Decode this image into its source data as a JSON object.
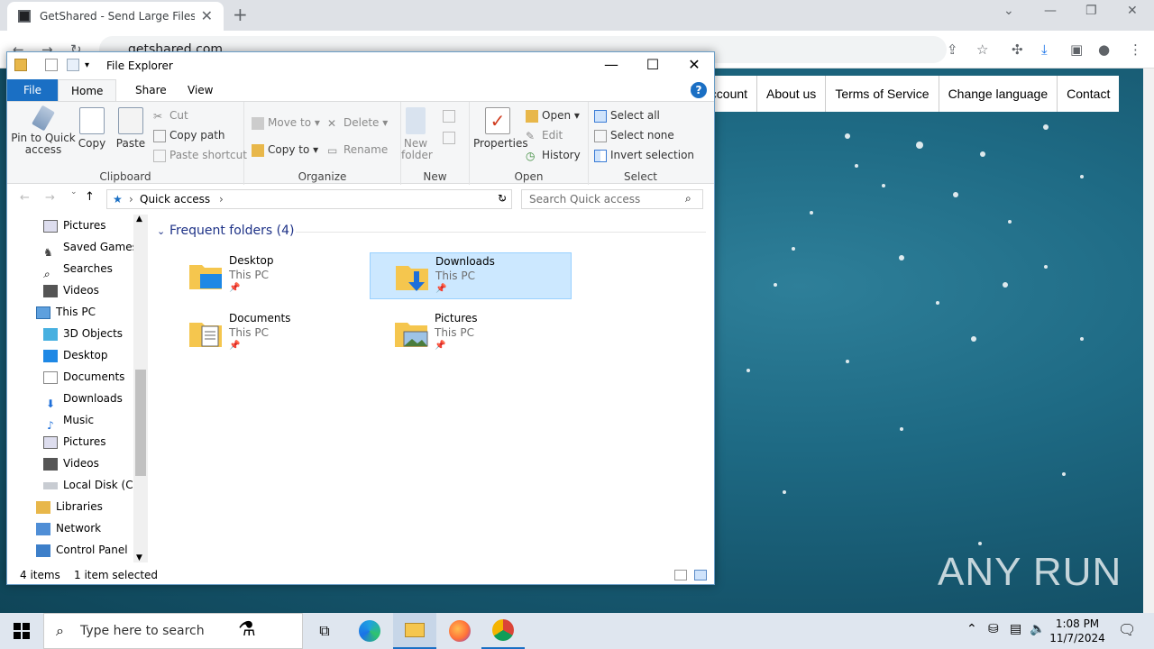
{
  "browser": {
    "tab_title": "GetShared - Send Large Files and",
    "url": "getshared.com",
    "nav_links": [
      "account",
      "About us",
      "Terms of Service",
      "Change language",
      "Contact"
    ]
  },
  "watermark": "ANY RUN",
  "explorer": {
    "title": "File Explorer",
    "tabs": [
      "File",
      "Home",
      "Share",
      "View"
    ],
    "ribbon": {
      "clipboard": {
        "pin": "Pin to Quick access",
        "copy": "Copy",
        "paste": "Paste",
        "cut": "Cut",
        "copy_path": "Copy path",
        "paste_shortcut": "Paste shortcut",
        "label": "Clipboard"
      },
      "organize": {
        "move_to": "Move to",
        "copy_to": "Copy to",
        "delete": "Delete",
        "rename": "Rename",
        "label": "Organize"
      },
      "new": {
        "new_folder": "New folder",
        "label": "New"
      },
      "open": {
        "properties": "Properties",
        "open": "Open",
        "edit": "Edit",
        "history": "History",
        "label": "Open"
      },
      "select": {
        "select_all": "Select all",
        "select_none": "Select none",
        "invert": "Invert selection",
        "label": "Select"
      }
    },
    "path": "Quick access",
    "search_placeholder": "Search Quick access",
    "nav_items": [
      "Pictures",
      "Saved Games",
      "Searches",
      "Videos",
      "This PC",
      "3D Objects",
      "Desktop",
      "Documents",
      "Downloads",
      "Music",
      "Pictures",
      "Videos",
      "Local Disk (C:)",
      "Libraries",
      "Network",
      "Control Panel"
    ],
    "section_title": "Frequent folders (4)",
    "folders": [
      {
        "name": "Desktop",
        "location": "This PC"
      },
      {
        "name": "Downloads",
        "location": "This PC"
      },
      {
        "name": "Documents",
        "location": "This PC"
      },
      {
        "name": "Pictures",
        "location": "This PC"
      }
    ],
    "status_items": "4 items",
    "status_selected": "1 item selected"
  },
  "taskbar": {
    "search_placeholder": "Type here to search",
    "time": "1:08 PM",
    "date": "11/7/2024"
  }
}
